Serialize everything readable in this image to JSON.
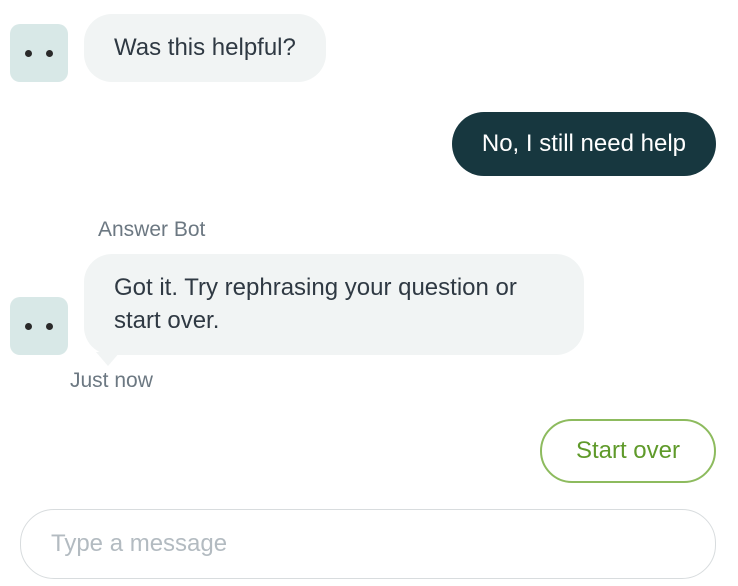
{
  "messages": {
    "bot1": "Was this helpful?",
    "user1": "No, I still need help",
    "bot2_sender": "Answer Bot",
    "bot2": "Got it. Try rephrasing your question or start over.",
    "bot2_timestamp": "Just now"
  },
  "actions": {
    "start_over": "Start over"
  },
  "composer": {
    "placeholder": "Type a message"
  }
}
